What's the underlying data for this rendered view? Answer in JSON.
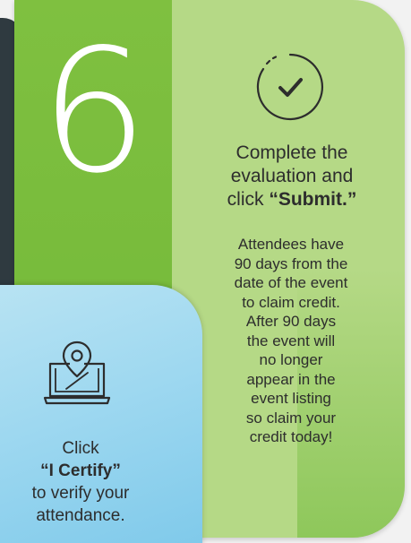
{
  "step": {
    "number": "6",
    "heading_line1": "Complete the",
    "heading_line2": "evaluation and",
    "heading_line3_prefix": "click ",
    "heading_line3_bold": "“Submit.”",
    "body_lines": [
      "Attendees have",
      "90 days from the",
      "date of the event",
      "to claim credit.",
      "After 90 days",
      "the event will",
      "no longer",
      "appear in the",
      "event listing",
      "so claim your",
      "credit today!"
    ],
    "icon": "check-circle-icon"
  },
  "certify": {
    "line1": "Click",
    "line2_bold": "“I Certify”",
    "line3": "to verify your",
    "line4": "attendance.",
    "icon": "laptop-location-pin-icon"
  },
  "colors": {
    "green_dark": "#77bb3b",
    "green_light": "#b5d986",
    "blue": "#9ed8f0",
    "text": "#2d2d2d"
  }
}
